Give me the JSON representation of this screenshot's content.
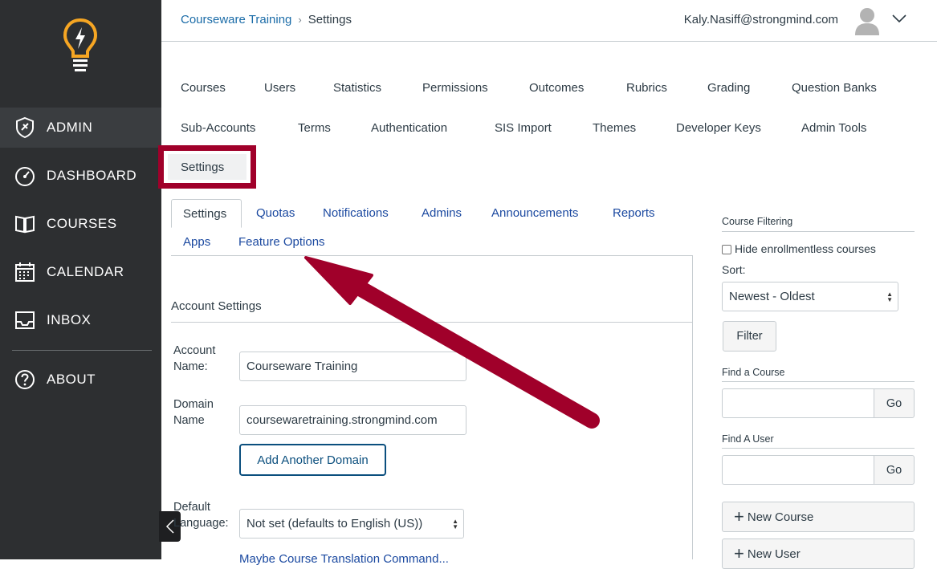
{
  "sidebar": {
    "items": [
      {
        "label": "ADMIN",
        "icon": "shield-icon"
      },
      {
        "label": "DASHBOARD",
        "icon": "dashboard-icon"
      },
      {
        "label": "COURSES",
        "icon": "book-icon"
      },
      {
        "label": "CALENDAR",
        "icon": "calendar-icon"
      },
      {
        "label": "INBOX",
        "icon": "inbox-icon"
      },
      {
        "label": "ABOUT",
        "icon": "question-icon"
      }
    ]
  },
  "header": {
    "breadcrumb_root": "Courseware Training",
    "breadcrumb_current": "Settings",
    "user_email": "Kaly.Nasiff@strongmind.com"
  },
  "admin_nav": {
    "row1": [
      "Courses",
      "Users",
      "Statistics",
      "Permissions",
      "Outcomes",
      "Rubrics",
      "Grading",
      "Question Banks"
    ],
    "row2": [
      "Sub-Accounts",
      "Terms",
      "Authentication",
      "SIS Import",
      "Themes",
      "Developer Keys",
      "Admin Tools"
    ],
    "settings": "Settings"
  },
  "tabs": {
    "active": "Settings",
    "items": [
      "Quotas",
      "Notifications",
      "Admins",
      "Announcements",
      "Reports",
      "Apps",
      "Feature Options"
    ]
  },
  "account_settings": {
    "title": "Account Settings",
    "account_name_label": "Account Name:",
    "account_name_value": "Courseware Training",
    "domain_name_label": "Domain Name",
    "domain_name_value": "coursewaretraining.strongmind.com",
    "add_domain_button": "Add Another Domain",
    "default_language_label": "Default Language:",
    "default_language_value": "Not set (defaults to English (US))",
    "cutoff_text": "Maybe Course Translation Command..."
  },
  "right_col": {
    "course_filtering_title": "Course Filtering",
    "hide_enrollmentless_label": "Hide enrollmentless courses",
    "sort_label": "Sort:",
    "sort_value": "Newest - Oldest",
    "filter_button": "Filter",
    "find_course_title": "Find a Course",
    "find_user_title": "Find A User",
    "go_label": "Go",
    "new_course_button": "New Course",
    "new_user_button": "New User"
  },
  "colors": {
    "sidebar_bg": "#2d2f31",
    "highlight": "#a0002a",
    "link": "#1b49a0",
    "logo": "#f6a623"
  }
}
